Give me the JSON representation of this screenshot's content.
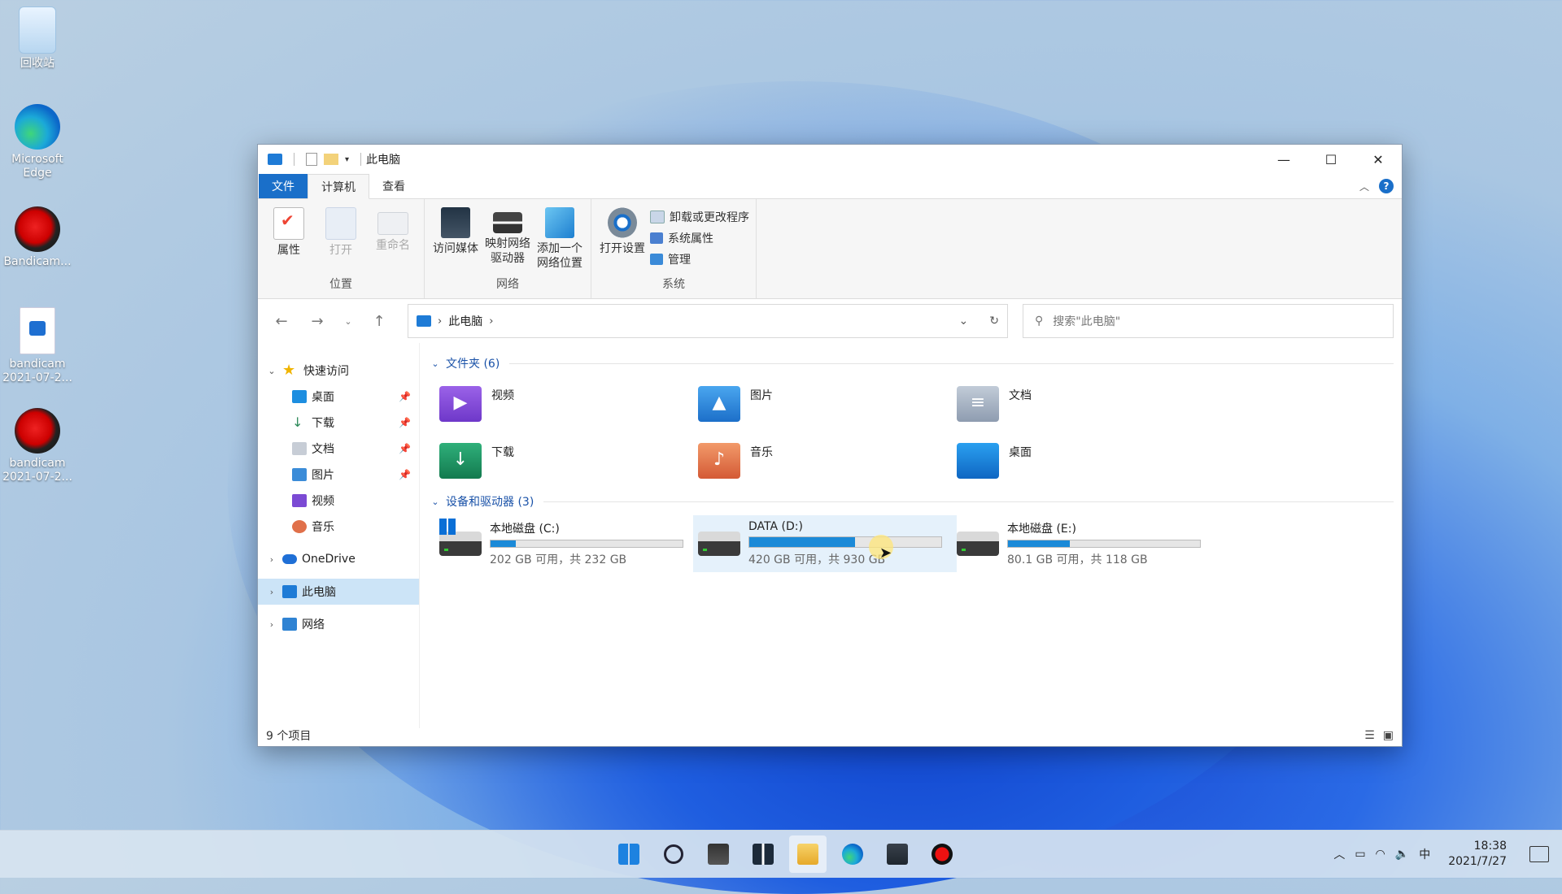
{
  "desktop": {
    "icons": [
      {
        "label": "回收站"
      },
      {
        "label": "Microsoft Edge"
      },
      {
        "label": "Bandicam..."
      },
      {
        "label": "bandicam 2021-07-2..."
      },
      {
        "label": "bandicam 2021-07-2..."
      }
    ]
  },
  "window": {
    "title": "此电脑",
    "controls": {
      "minimize": "—",
      "maximize": "☐",
      "close": "✕"
    }
  },
  "ribbon": {
    "tabs": [
      "文件",
      "计算机",
      "查看"
    ],
    "help": "?",
    "groups": {
      "location": {
        "label": "位置",
        "buttons": [
          "属性",
          "打开",
          "重命名"
        ]
      },
      "network": {
        "label": "网络",
        "buttons": [
          "访问媒体",
          "映射网络驱动器",
          "添加一个网络位置"
        ]
      },
      "system": {
        "label": "系统",
        "open_settings": "打开设置",
        "links": [
          "卸载或更改程序",
          "系统属性",
          "管理"
        ]
      }
    }
  },
  "address": {
    "path": "此电脑",
    "search_placeholder": "搜索\"此电脑\""
  },
  "nav": {
    "quick_access": "快速访问",
    "pinned": [
      "桌面",
      "下载",
      "文档",
      "图片",
      "视频",
      "音乐"
    ],
    "onedrive": "OneDrive",
    "this_pc": "此电脑",
    "network": "网络"
  },
  "folders": {
    "header": "文件夹 (6)",
    "items": [
      "视频",
      "图片",
      "文档",
      "下载",
      "音乐",
      "桌面"
    ]
  },
  "drives": {
    "header": "设备和驱动器 (3)",
    "items": [
      {
        "name": "本地磁盘 (C:)",
        "free": "202 GB 可用，共 232 GB",
        "used_fraction": 0.13
      },
      {
        "name": "DATA (D:)",
        "free": "420 GB 可用，共 930 GB",
        "used_fraction": 0.55
      },
      {
        "name": "本地磁盘 (E:)",
        "free": "80.1 GB 可用，共 118 GB",
        "used_fraction": 0.32
      }
    ]
  },
  "status": {
    "count": "9 个项目"
  },
  "taskbar": {
    "tray_ime": "中",
    "time": "18:38",
    "date": "2021/7/27"
  },
  "colors": {
    "accent": "#1a6fc9",
    "selection": "#cce4f7",
    "drive_bar": "#1b8ad8"
  }
}
